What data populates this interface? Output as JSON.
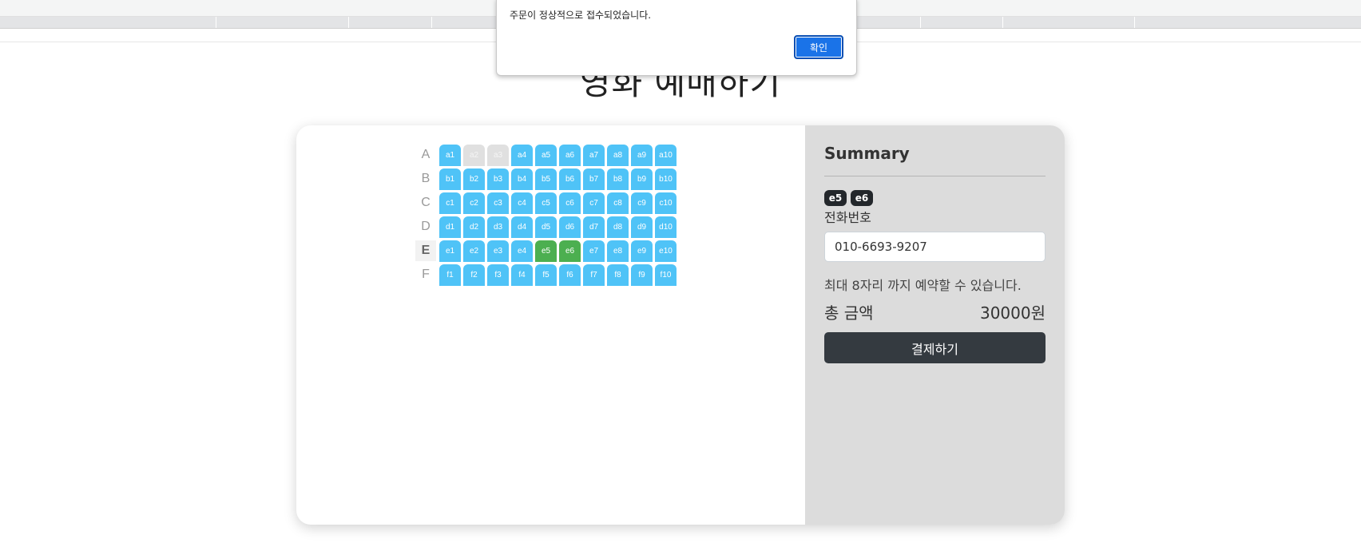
{
  "page": {
    "title": "영화 예매하기"
  },
  "alert": {
    "message": "주문이 정상적으로 접수되었습니다.",
    "ok_label": "확인"
  },
  "seat_map": {
    "rows": [
      "A",
      "B",
      "C",
      "D",
      "E",
      "F"
    ],
    "active_row": "E",
    "seats": [
      [
        "a1",
        "a2",
        "a3",
        "a4",
        "a5",
        "a6",
        "a7",
        "a8",
        "a9",
        "a10"
      ],
      [
        "b1",
        "b2",
        "b3",
        "b4",
        "b5",
        "b6",
        "b7",
        "b8",
        "b9",
        "b10"
      ],
      [
        "c1",
        "c2",
        "c3",
        "c4",
        "c5",
        "c6",
        "c7",
        "c8",
        "c9",
        "c10"
      ],
      [
        "d1",
        "d2",
        "d3",
        "d4",
        "d5",
        "d6",
        "d7",
        "d8",
        "d9",
        "d10"
      ],
      [
        "e1",
        "e2",
        "e3",
        "e4",
        "e5",
        "e6",
        "e7",
        "e8",
        "e9",
        "e10"
      ],
      [
        "f1",
        "f2",
        "f3",
        "f4",
        "f5",
        "f6",
        "f7",
        "f8",
        "f9",
        "f10"
      ]
    ],
    "taken": [
      "a2",
      "a3"
    ],
    "selected": [
      "e5",
      "e6"
    ],
    "colors": {
      "available": "#4fc3f7",
      "taken": "#e0e0e0",
      "selected": "#4caf50"
    }
  },
  "summary": {
    "title": "Summary",
    "selected_chips": [
      "e5",
      "e6"
    ],
    "phone_label": "전화번호",
    "phone_value": "010-6693-9207",
    "max_note": "최대 8자리 까지 예약할 수 있습니다.",
    "total_label": "총 금액",
    "total_value": "30000원",
    "pay_label": "결제하기"
  }
}
